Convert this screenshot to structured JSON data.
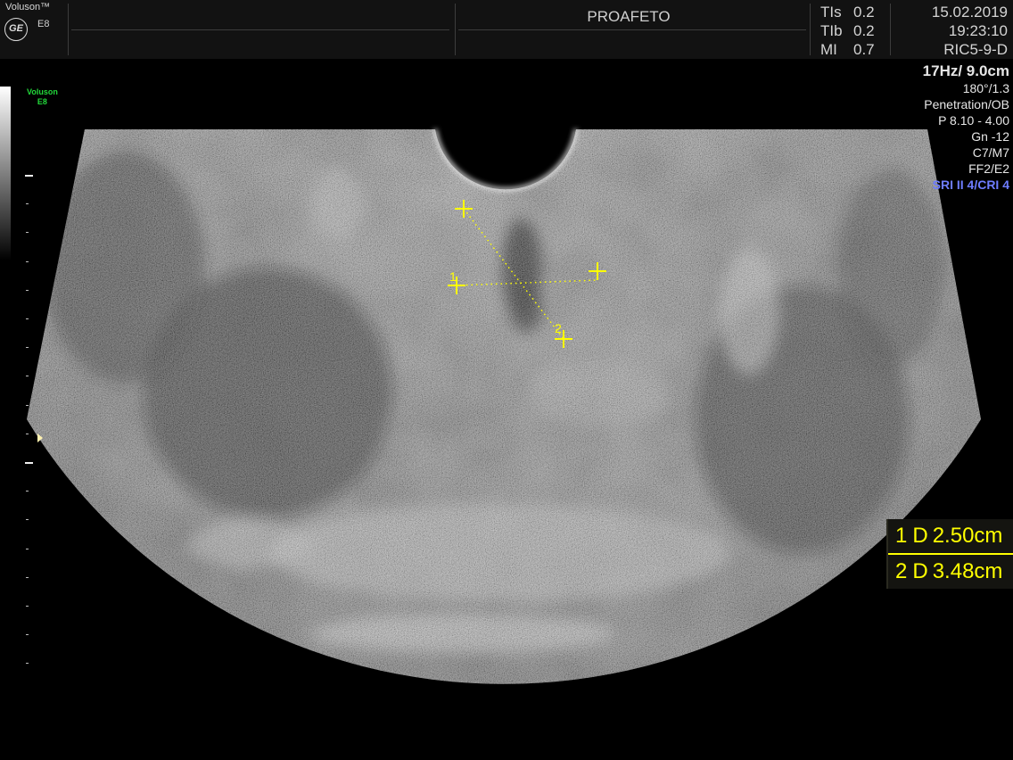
{
  "header": {
    "brand": "Voluson™",
    "logo_text": "GE",
    "model": "E8",
    "patient_name": "PROAFETO",
    "indices": [
      {
        "label": "TIs",
        "value": "0.2"
      },
      {
        "label": "TIb",
        "value": "0.2"
      },
      {
        "label": "MI",
        "value": "0.7"
      }
    ],
    "date": "15.02.2019",
    "time": "19:23:10",
    "probe": "RIC5-9-D"
  },
  "parameters": {
    "frequency_depth": "17Hz/ 9.0cm",
    "angle": "180°/1.3",
    "preset": "Penetration/OB",
    "power": "P 8.10 - 4.00",
    "gain": "Gn -12",
    "maps": "C7/M7",
    "filters": "FF2/E2",
    "sri": "SRI II 4/CRI 4"
  },
  "side_logo": {
    "line1": "Voluson",
    "line2": "E8"
  },
  "calipers": [
    {
      "label": "1"
    },
    {
      "label": "2"
    }
  ],
  "measurements": [
    {
      "index": "1",
      "type": "D",
      "value": "2.50cm"
    },
    {
      "index": "2",
      "type": "D",
      "value": "3.48cm"
    }
  ],
  "colors": {
    "caliper": "#ffff00",
    "sri_text": "#6e7dff",
    "side_logo": "#22d83a"
  },
  "icons": [
    "ge-logo-icon",
    "focus-marker-icon",
    "caliper-cross-icon"
  ]
}
